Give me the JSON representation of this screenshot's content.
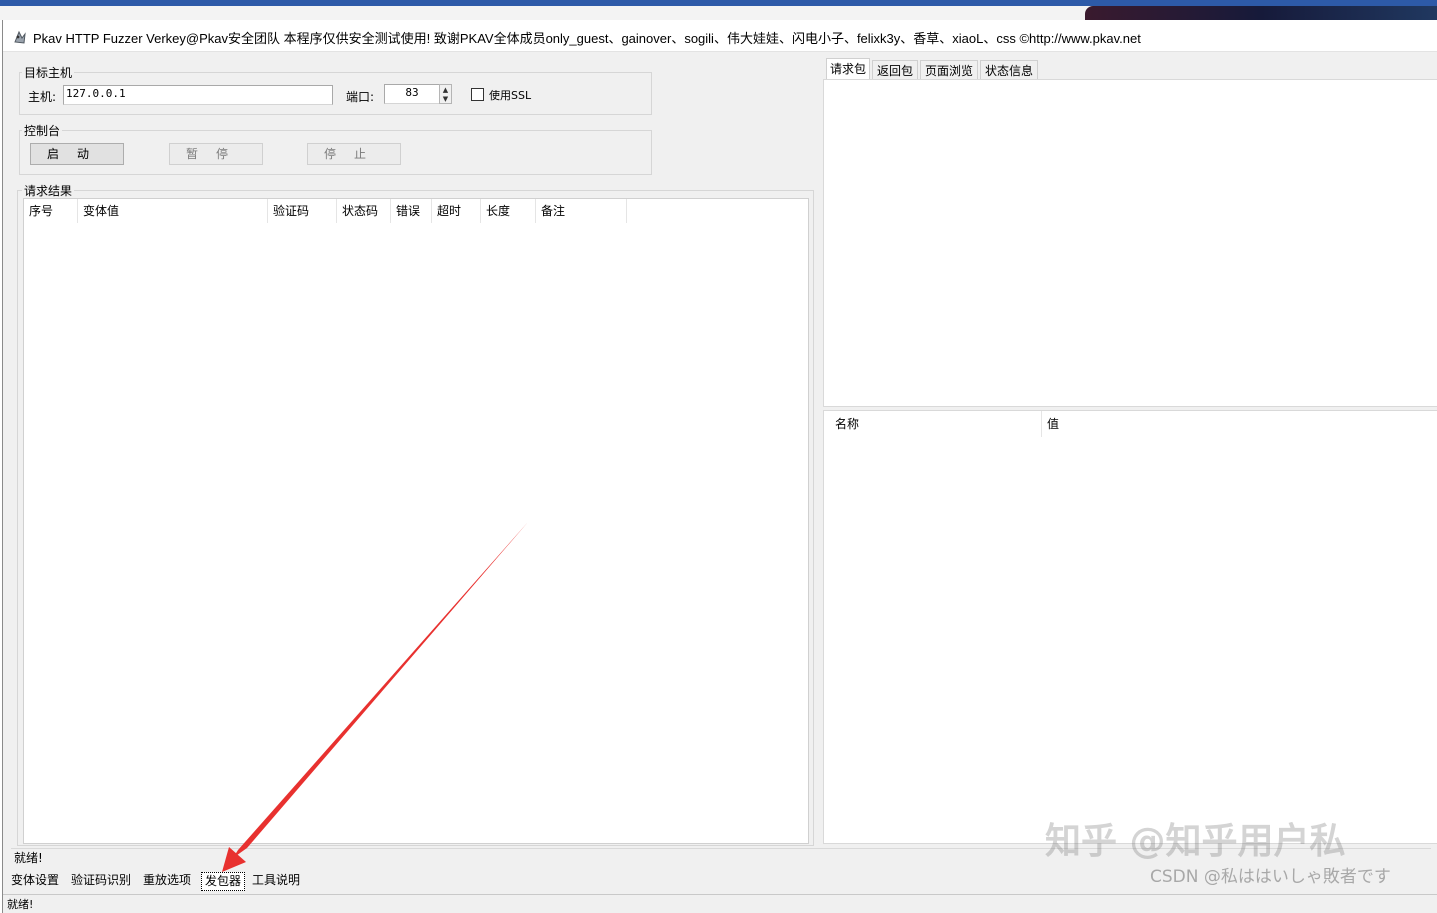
{
  "window": {
    "title": "Pkav HTTP Fuzzer   Verkey@Pkav安全团队  本程序仅供安全测试使用!  致谢PKAV全体成员only_guest、gainover、sogili、伟大娃娃、闪电小子、felixk3y、香草、xiaoL、css  ©http://www.pkav.net"
  },
  "target_host": {
    "group_label": "目标主机",
    "host_label": "主机:",
    "host_value": "127.0.0.1",
    "port_label": "端口:",
    "port_value": "83",
    "ssl_label": "使用SSL",
    "ssl_checked": false
  },
  "console": {
    "group_label": "控制台",
    "start_label": "启动",
    "pause_label": "暂停",
    "stop_label": "停止"
  },
  "results": {
    "group_label": "请求结果",
    "columns": [
      "序号",
      "变体值",
      "验证码",
      "状态码",
      "错误",
      "超时",
      "长度",
      "备注"
    ],
    "rows": []
  },
  "right_panel": {
    "tabs": [
      "请求包",
      "返回包",
      "页面浏览",
      "状态信息"
    ],
    "active_tab": "请求包",
    "table_columns": [
      "名称",
      "值"
    ]
  },
  "status_line": "就绪!",
  "bottom_tabs": [
    "变体设置",
    "验证码识别",
    "重放选项",
    "发包器",
    "工具说明"
  ],
  "active_bottom_tab": "发包器",
  "status_bar": "就绪!",
  "watermarks": {
    "zhihu": "知乎 @知乎用户私",
    "csdn": "CSDN @私ははいしゃ敗者です"
  },
  "colors": {
    "annotation_arrow": "#e8312f",
    "window_bg": "#f0f0f0",
    "accent_top": "#2d5aa8"
  }
}
